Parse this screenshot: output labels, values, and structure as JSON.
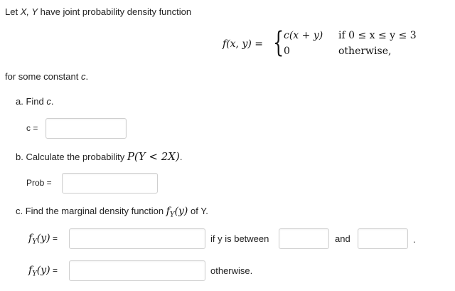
{
  "intro": {
    "line1_prefix": "Let ",
    "vars": "X, Y",
    "line1_suffix": " have joint probability density function",
    "fxy_label": "f(x, y) =",
    "case1_expr": "c(x + y)",
    "case1_cond": "if 0 ≤ x ≤ y ≤ 3",
    "case2_expr": "0",
    "case2_cond": "otherwise,",
    "constant_prefix": "for some constant ",
    "constant_var": "c",
    "constant_suffix": "."
  },
  "part_a": {
    "heading_prefix": "a. Find ",
    "heading_var": "c",
    "heading_suffix": ".",
    "field_label": "c =",
    "field_value": ""
  },
  "part_b": {
    "heading_prefix": "b. Calculate the probability ",
    "heading_math": "P(Y < 2X)",
    "heading_suffix": ".",
    "field_label": "Prob =",
    "field_value": ""
  },
  "part_c": {
    "heading_prefix": "c. Find the marginal density function ",
    "heading_math": "f",
    "heading_sub": "Y",
    "heading_arg": "(y)",
    "heading_suffix": " of Y.",
    "row1": {
      "label_f": "f",
      "label_sub": "Y",
      "label_arg": "(y)",
      "label_eq": " =",
      "between_text": "if y is between",
      "and_text": "and",
      "period": ".",
      "field_value": "",
      "lower_value": "",
      "upper_value": ""
    },
    "row2": {
      "label_f": "f",
      "label_sub": "Y",
      "label_arg": "(y)",
      "label_eq": " =",
      "otherwise_text": "otherwise.",
      "field_value": ""
    }
  }
}
